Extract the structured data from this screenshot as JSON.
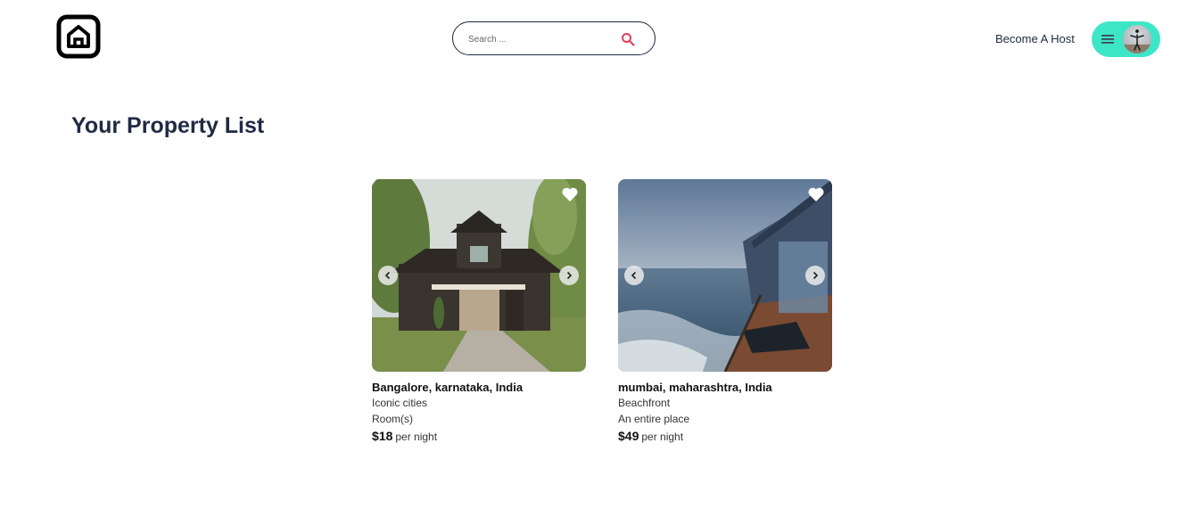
{
  "header": {
    "search_placeholder": "Search ...",
    "become_host": "Become A Host",
    "accent_color": "#3ee6c8",
    "search_icon_color": "#e0405e"
  },
  "main": {
    "title": "Your Property List"
  },
  "properties": [
    {
      "location": "Bangalore, karnataka, India",
      "category": "Iconic cities",
      "type": "Room(s)",
      "price": "$18",
      "price_unit": "per night",
      "image": "wooden-barn-house"
    },
    {
      "location": "mumbai, maharashtra, India",
      "category": "Beachfront",
      "type": "An entire place",
      "price": "$49",
      "price_unit": "per night",
      "image": "beachfront-deck-ocean"
    }
  ]
}
